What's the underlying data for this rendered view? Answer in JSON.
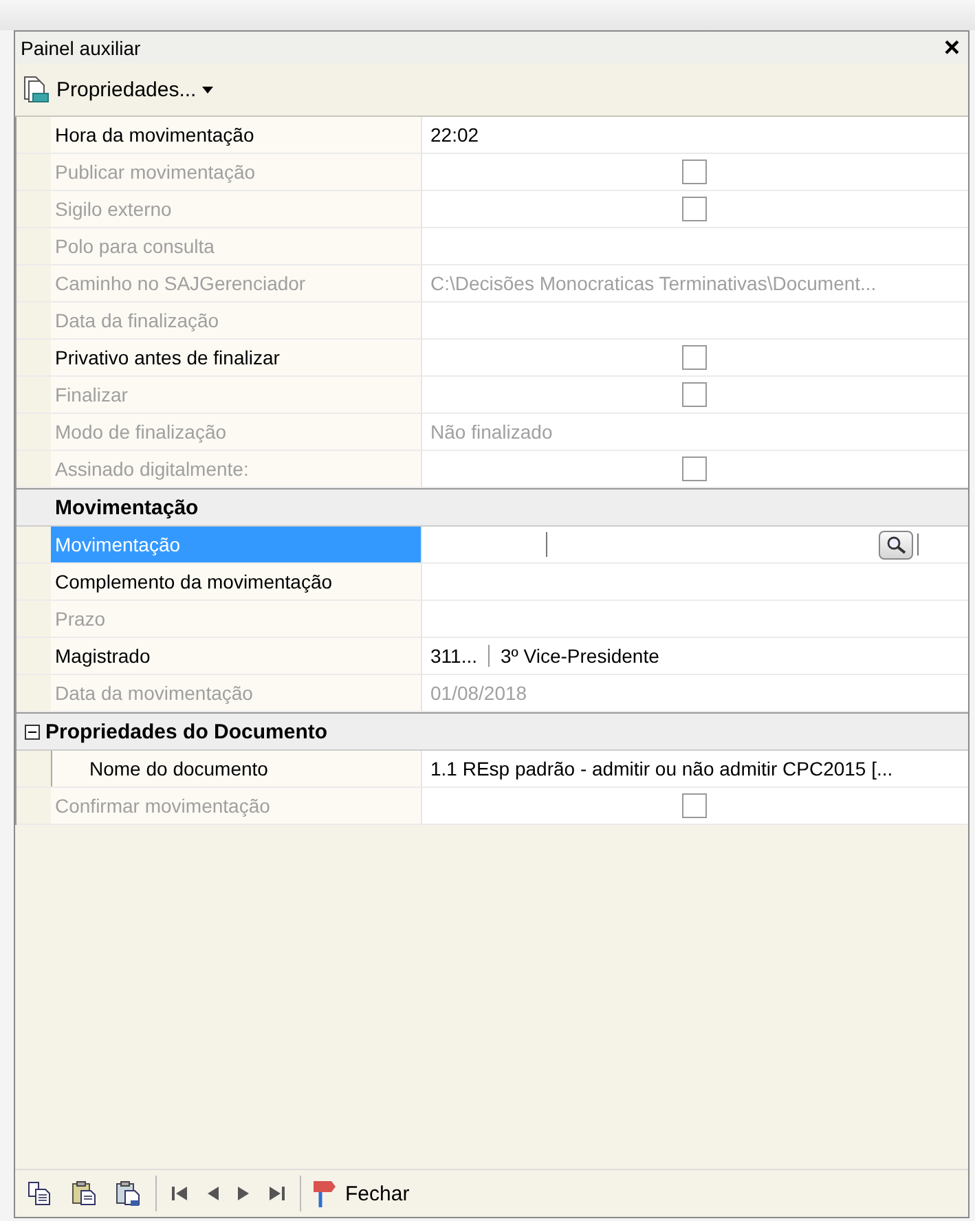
{
  "window": {
    "title": "Painel auxiliar",
    "close": "×"
  },
  "toolbar": {
    "menu_label": "Propriedades..."
  },
  "grid": [
    {
      "kind": "text",
      "label": "Hora da movimentação",
      "disabled": false,
      "selected": false,
      "value": "22:02"
    },
    {
      "kind": "checkbox",
      "label": "Publicar movimentação",
      "disabled": true,
      "selected": false,
      "checked": false
    },
    {
      "kind": "checkbox",
      "label": "Sigilo externo",
      "disabled": true,
      "selected": false,
      "checked": false
    },
    {
      "kind": "text",
      "label": "Polo para consulta",
      "disabled": true,
      "selected": false
    },
    {
      "kind": "text",
      "label": "Caminho no SAJGerenciador",
      "disabled": true,
      "selected": false,
      "value": "C:\\Decisões Monocraticas Terminativas\\Document..."
    },
    {
      "kind": "text",
      "label": "Data da finalização",
      "disabled": true,
      "selected": false
    },
    {
      "kind": "checkbox",
      "label": "Privativo antes de finalizar",
      "disabled": false,
      "selected": false,
      "checked": false
    },
    {
      "kind": "checkbox",
      "label": "Finalizar",
      "disabled": true,
      "selected": false,
      "checked": false
    },
    {
      "kind": "text",
      "label": "Modo de finalização",
      "disabled": true,
      "selected": false,
      "value": "Não finalizado"
    },
    {
      "kind": "checkbox",
      "label": "Assinado digitalmente:",
      "disabled": true,
      "selected": false,
      "checked": false
    },
    {
      "kind": "category",
      "title": "Movimentação",
      "rows": [
        {
          "kind": "lookup",
          "label": "Movimentação",
          "disabled": false,
          "selected": true
        },
        {
          "kind": "text",
          "label": "Complemento da movimentação",
          "disabled": false,
          "selected": false
        },
        {
          "kind": "text",
          "label": "Prazo",
          "disabled": true,
          "selected": false
        },
        {
          "kind": "pair",
          "label": "Magistrado",
          "disabled": false,
          "selected": false,
          "values": [
            "311...",
            "3º Vice-Presidente"
          ]
        },
        {
          "kind": "text",
          "label": "Data da movimentação",
          "disabled": true,
          "selected": false,
          "value": "01/08/2018"
        }
      ]
    },
    {
      "kind": "category",
      "title": "Propriedades do Documento",
      "expanded": true,
      "rows": [
        {
          "kind": "text",
          "label": "Nome do documento",
          "disabled": false,
          "selected": false,
          "value": "1.1 REsp padrão - admitir ou não admitir CPC2015 [..."
        }
      ]
    },
    {
      "kind": "checkbox",
      "label": "Confirmar movimentação",
      "disabled": true,
      "selected": false,
      "checked": false
    }
  ],
  "footer": {
    "close_label": "Fechar"
  }
}
